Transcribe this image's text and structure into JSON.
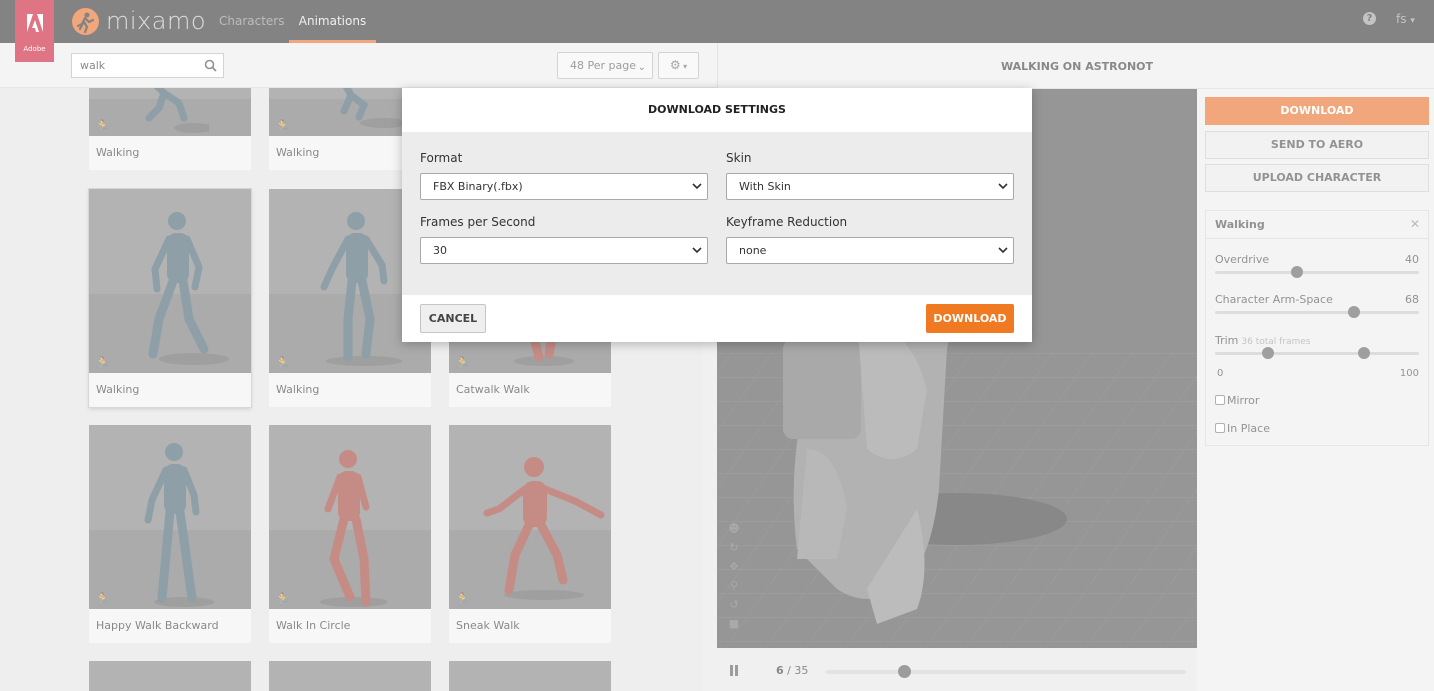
{
  "nav": {
    "adobe_label": "Adobe",
    "brand": "mixamo",
    "tabs": [
      "Characters",
      "Animations"
    ],
    "user": "fs"
  },
  "toolbar": {
    "search_value": "walk",
    "per_page": "48 Per page"
  },
  "cards": [
    {
      "label": "Walking",
      "figure": "teal"
    },
    {
      "label": "Walking",
      "figure": "teal"
    },
    {
      "label": "Walking",
      "figure": "teal"
    },
    {
      "label": "Walking",
      "figure": "teal"
    },
    {
      "label": "Catwalk Walk",
      "figure": "red"
    },
    {
      "label": "Happy Walk Backward",
      "figure": "teal"
    },
    {
      "label": "Walk In Circle",
      "figure": "red"
    },
    {
      "label": "Sneak Walk",
      "figure": "red"
    }
  ],
  "viewer": {
    "title": "WALKING ON ASTRONOT",
    "current_frame": "6",
    "total_frames": "35",
    "progress": 0.2
  },
  "sidebar": {
    "download": "DOWNLOAD",
    "send_to_aero": "SEND TO AERO",
    "upload_character": "UPLOAD CHARACTER",
    "panel_title": "Walking",
    "overdrive_label": "Overdrive",
    "overdrive_value": "40",
    "overdrive_level": 0.4,
    "armspace_label": "Character Arm-Space",
    "armspace_value": "68",
    "armspace_level": 0.68,
    "trim_label": "Trim",
    "trim_sub": "36 total frames",
    "trim_start": "0",
    "trim_end": "100",
    "trim_low": 0.26,
    "trim_high": 0.73,
    "mirror_label": "Mirror",
    "inplace_label": "In Place"
  },
  "modal": {
    "title": "DOWNLOAD SETTINGS",
    "format_label": "Format",
    "format_value": "FBX Binary(.fbx)",
    "skin_label": "Skin",
    "skin_value": "With Skin",
    "fps_label": "Frames per Second",
    "fps_value": "30",
    "keyframe_label": "Keyframe Reduction",
    "keyframe_value": "none",
    "cancel": "CANCEL",
    "download": "DOWNLOAD"
  },
  "colors": {
    "accent": "#e8661c",
    "teal_figure": "#3d5a68",
    "red_figure": "#9c3a30",
    "adobe_red": "#c8102e"
  }
}
